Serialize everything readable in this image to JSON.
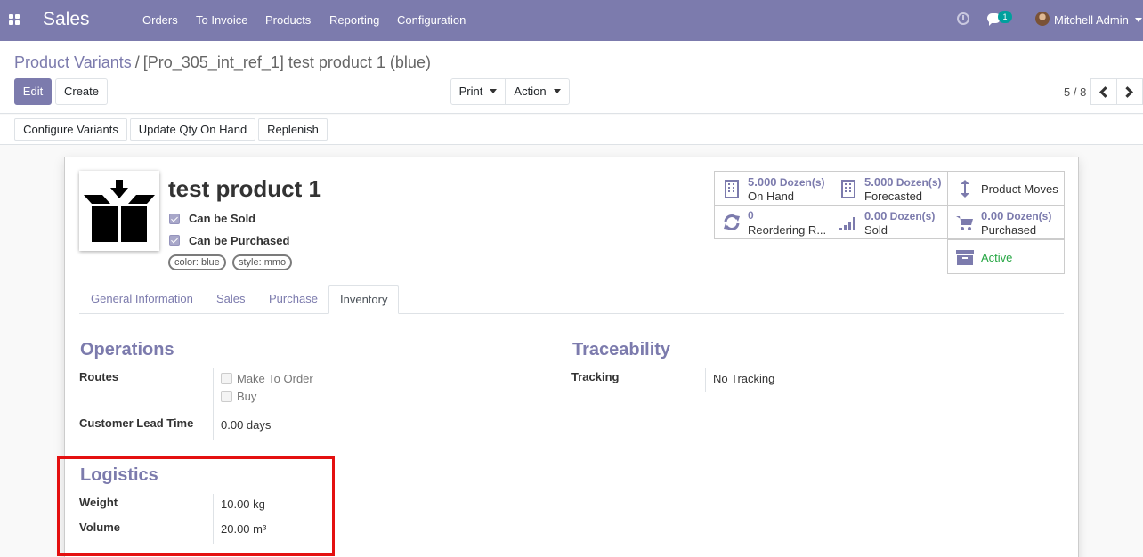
{
  "navbar": {
    "brand": "Sales",
    "menu": [
      "Orders",
      "To Invoice",
      "Products",
      "Reporting",
      "Configuration"
    ],
    "messages_count": "1",
    "user_name": "Mitchell Admin",
    "color": "#7c7bad"
  },
  "breadcrumb": {
    "parent": "Product Variants",
    "separator": "/",
    "current": "[Pro_305_int_ref_1] test product 1 (blue)"
  },
  "buttons": {
    "edit": "Edit",
    "create": "Create",
    "print": "Print",
    "action": "Action"
  },
  "pager": {
    "value": "5 / 8"
  },
  "statusbar": {
    "configure_variants": "Configure Variants",
    "update_qty": "Update Qty On Hand",
    "replenish": "Replenish"
  },
  "product": {
    "name": "test product 1",
    "can_be_sold_label": "Can be Sold",
    "can_be_purchased_label": "Can be Purchased",
    "tags": [
      "color: blue",
      "style: mmo"
    ]
  },
  "smart_buttons": {
    "on_hand_value": "5.000",
    "on_hand_unit": "Dozen(s)",
    "on_hand_label": "On Hand",
    "forecasted_value": "5.000",
    "forecasted_unit": "Dozen(s)",
    "forecasted_label": "Forecasted",
    "product_moves_label": "Product Moves",
    "reordering_value": "0",
    "reordering_label": "Reordering R...",
    "sold_value": "0.00",
    "sold_unit": "Dozen(s)",
    "sold_label": "Sold",
    "purchased_value": "0.00",
    "purchased_unit": "Dozen(s)",
    "purchased_label": "Purchased",
    "active_label": "Active"
  },
  "tabs": [
    "General Information",
    "Sales",
    "Purchase",
    "Inventory"
  ],
  "operations": {
    "title": "Operations",
    "routes_label": "Routes",
    "route_options": [
      "Make To Order",
      "Buy"
    ],
    "lead_time_label": "Customer Lead Time",
    "lead_time_value": "0.00 days"
  },
  "traceability": {
    "title": "Traceability",
    "tracking_label": "Tracking",
    "tracking_value": "No Tracking"
  },
  "logistics": {
    "title": "Logistics",
    "weight_label": "Weight",
    "weight_value": "10.00",
    "weight_unit": "kg",
    "volume_label": "Volume",
    "volume_value": "20.00",
    "volume_unit": "m³"
  },
  "colors": {
    "accent": "#7c7bad",
    "active_green": "#28a745",
    "highlight_red": "#e41010"
  }
}
